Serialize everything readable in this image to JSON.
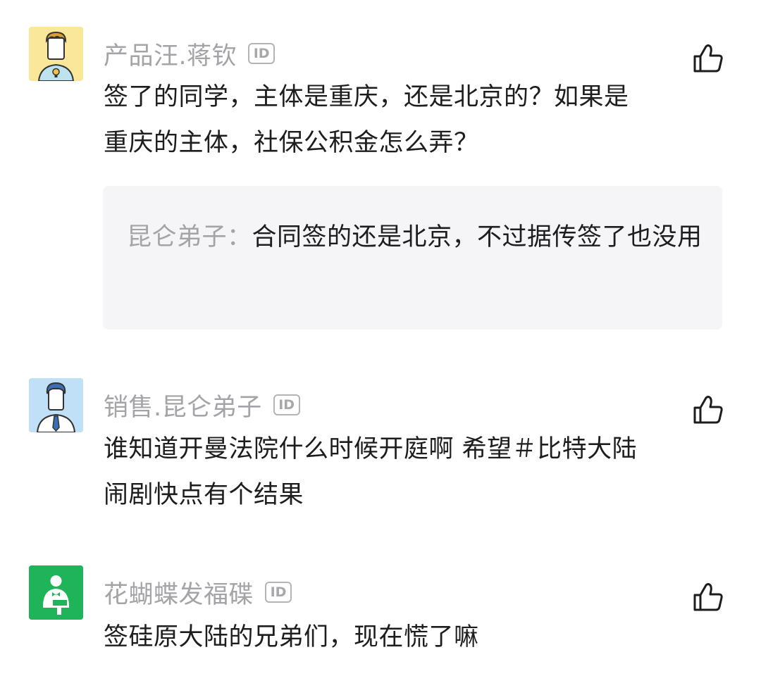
{
  "comments": [
    {
      "author": "产品汪.蒋钦",
      "id_badge": "ID",
      "avatar_icon": "product-lightbulb-avatar-icon",
      "line1": "签了的同学，主体是重庆，还是北京的？如果是",
      "line2": "重庆的主体，社保公积金怎么弄？",
      "reply": {
        "author": "昆仑弟子：",
        "text": "合同签的还是北京，不过据传签了也没用"
      }
    },
    {
      "author": "销售.昆仑弟子",
      "id_badge": "ID",
      "avatar_icon": "sales-tie-avatar-icon",
      "line1": "谁知道开曼法院什么时候开庭啊 希望＃比特大陆",
      "line2": "闹剧快点有个结果"
    },
    {
      "author": "花蝴蝶发福碟",
      "id_badge": "ID",
      "avatar_icon": "waiter-avatar-icon",
      "line1": "签硅原大陆的兄弟们，现在慌了嘛"
    }
  ],
  "colors": {
    "name": "#a3a3a8",
    "text": "#1d1d1f",
    "reply_bg": "#f5f5f7",
    "avatar1_bg": "#fbe79a",
    "avatar2_bg": "#bfe0f6",
    "avatar3_bg": "#1fb45a"
  },
  "icons": {
    "like": "thumbs-up-icon"
  }
}
